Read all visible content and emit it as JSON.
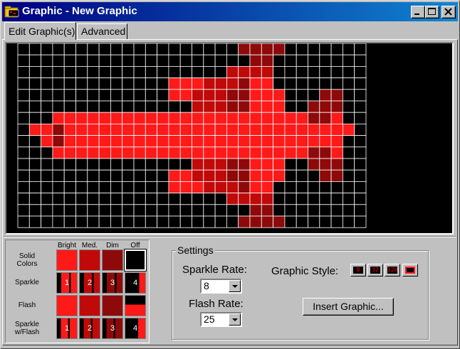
{
  "window": {
    "title": "Graphic - New Graphic",
    "colors": {
      "title_start": "#000080",
      "title_end": "#1084d0",
      "bright": "#ff1a1a",
      "medium": "#c00a0a",
      "dim": "#8e0a0a",
      "off": "#000000"
    }
  },
  "tabs": [
    {
      "label": "Edit Graphic(s)",
      "active": true
    },
    {
      "label": "Advanced",
      "active": false
    }
  ],
  "grid": {
    "columns": 30,
    "rows": 16,
    "grid_color": "#ffffff",
    "legend": {
      ".": "off",
      "B": "bright",
      "M": "medium",
      "D": "dim"
    },
    "pixels": [
      "...................DDDD.......",
      "....................DD........",
      "..................MMMM........",
      ".............BBBMMMDBB........",
      ".............BBMMMDDBBB...DD..",
      "...............MMMDDBBB..DDD..",
      "...BBBBBBBBBBBBBBBBBBBBBBDDB..",
      ".BBDBBBBBBBBBBBBBBBBBBBBBBBBB.",
      "..BDBBBBBBBBBBBBBBBBBBBBBBBB..",
      "...BBBBBBBBBBBBBBBBBBBBBBDDB..",
      "...............MMMDDBBB..DDD..",
      ".............BBMMMDDBBB...DD..",
      ".............BBBMMMDBB........",
      "..................MMMM........",
      "....................DD........",
      "...................DDDD......."
    ]
  },
  "color_picker": {
    "column_headers": [
      "Bright",
      "Med.",
      "Dim",
      "Off"
    ],
    "rows": [
      {
        "label_line1": "Solid",
        "label_line2": "Colors",
        "type": "solid"
      },
      {
        "label_line1": "Sparkle",
        "label_line2": "",
        "type": "sparkle",
        "numbers": [
          "1",
          "2",
          "3",
          "4"
        ]
      },
      {
        "label_line1": "Flash",
        "label_line2": "",
        "type": "flash"
      },
      {
        "label_line1": "Sparkle",
        "label_line2": "w/Flash",
        "type": "sparkle_flash",
        "numbers": [
          "1",
          "2",
          "3",
          "4"
        ]
      }
    ],
    "selected": "solid-off"
  },
  "settings": {
    "group_title": "Settings",
    "sparkle_rate_label": "Sparkle Rate:",
    "sparkle_rate_value": "8",
    "flash_rate_label": "Flash Rate:",
    "flash_rate_value": "25",
    "graphic_style_label": "Graphic Style:",
    "graphic_style_options": [
      "8",
      "32",
      "120",
      "full"
    ],
    "graphic_style_selected": "full",
    "insert_button_label": "Insert Graphic..."
  }
}
